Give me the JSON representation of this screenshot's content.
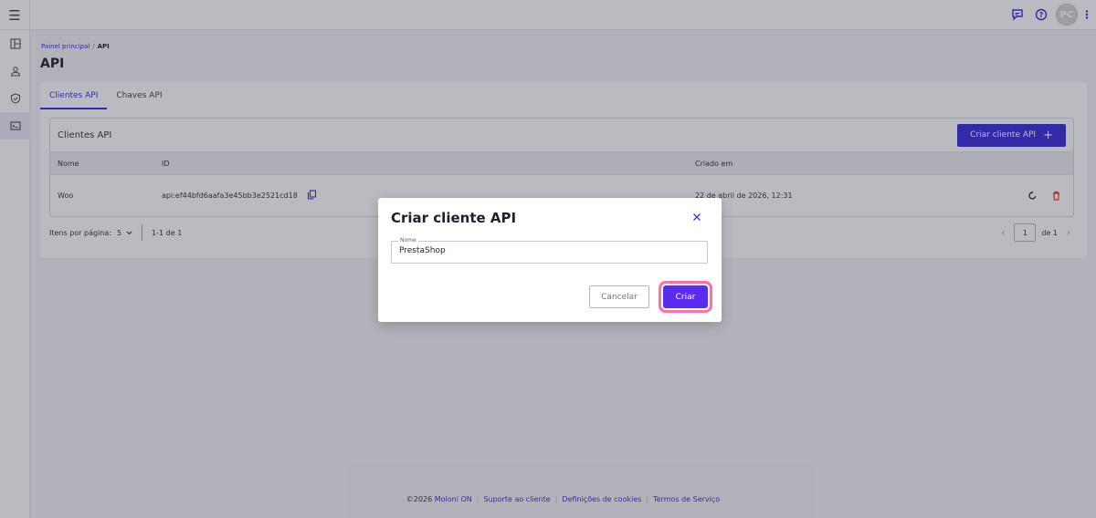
{
  "topbar": {
    "menu_icon": "hamburger-icon",
    "avatar_initials": "PC"
  },
  "rail": {
    "items": [
      "dashboard-icon",
      "user-icon",
      "shield-icon",
      "terminal-icon"
    ]
  },
  "breadcrumb": {
    "home": "Painel principal",
    "separator": "/",
    "current": "API"
  },
  "page": {
    "title": "API"
  },
  "tabs": [
    {
      "label": "Clientes API",
      "active": true
    },
    {
      "label": "Chaves API",
      "active": false
    }
  ],
  "table": {
    "title": "Clientes API",
    "create_label": "Criar cliente API",
    "columns": [
      "Nome",
      "ID",
      "Criado em"
    ],
    "rows": [
      {
        "name": "Woo",
        "id": "api:ef44bfd6aafa3e45bb3e2521cd18",
        "created": "22 de abril de 2026, 12:31"
      }
    ]
  },
  "pager": {
    "per_page_label": "Itens por página:",
    "per_page_value": "5",
    "range": "1-1 de 1",
    "page": "1",
    "of": "de 1"
  },
  "footer": {
    "copyright": "©2026",
    "links": [
      "Moloni ON",
      "Suporte ao cliente",
      "Definições de cookies",
      "Termos de Serviço"
    ]
  },
  "modal": {
    "title": "Criar cliente API",
    "field_label": "Nome",
    "field_value": "PrestaShop",
    "cancel_label": "Cancelar",
    "create_label": "Criar"
  },
  "colors": {
    "accent": "#3a2ad8",
    "primary_button": "#5a2cf0",
    "focus_ring": "#ff6fae",
    "delete": "#e0302a"
  }
}
